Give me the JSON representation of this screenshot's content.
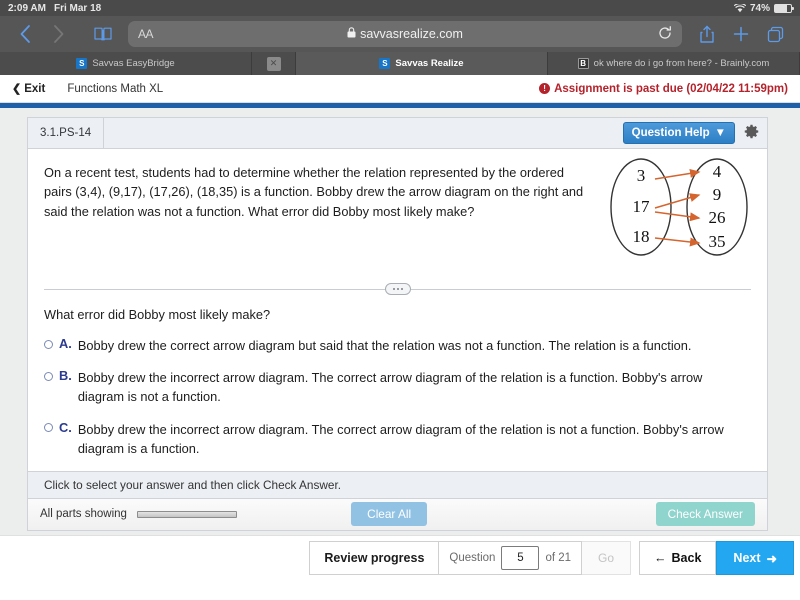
{
  "status_bar": {
    "time": "2:09 AM",
    "date": "Fri Mar 18",
    "battery_percent": "74%",
    "wifi_icon": "wifi-icon"
  },
  "browser": {
    "back_icon": "chevron-left-icon",
    "forward_icon": "chevron-right-icon",
    "bookmarks_icon": "book-icon",
    "text_size_label": "AA",
    "lock_icon": "lock-icon",
    "url": "savvasrealize.com",
    "reload_icon": "reload-icon",
    "share_icon": "share-icon",
    "new_tab_icon": "plus-icon",
    "tabs_icon": "tabs-icon",
    "tabs": [
      {
        "title": "Savvas EasyBridge",
        "favicon": "savvas-favicon",
        "active": false
      },
      {
        "title": "Savvas Realize",
        "favicon": "savvas-favicon",
        "active": true
      },
      {
        "title": "ok where do i go from here? - Brainly.com",
        "favicon": "brainly-favicon",
        "active": false
      }
    ],
    "close_tab_icon": "close-icon"
  },
  "app_bar": {
    "exit_label": "Exit",
    "exit_icon": "chevron-left-icon",
    "assignment_title": "Functions Math XL",
    "alert_icon": "exclamation-icon",
    "past_due_text": "Assignment is past due (02/04/22 11:59pm)"
  },
  "question_card": {
    "question_id": "3.1.PS-14",
    "question_help_label": "Question Help",
    "question_help_caret": "caret-down-icon",
    "settings_icon": "gear-icon",
    "question_text": "On a recent test, students had to determine whether the relation represented by the ordered pairs (3,4), (9,17), (17,26), (18,35) is a function. Bobby drew the arrow diagram on the right and said the relation was not a function. What error did Bobby most likely make?",
    "prompt": "What error did Bobby most likely make?",
    "splitter_icon": "drag-handle-icon",
    "diagram": {
      "left_set": [
        "3",
        "17",
        "18"
      ],
      "right_set": [
        "4",
        "9",
        "26",
        "35"
      ],
      "arrows": [
        {
          "from": "3",
          "to": "4"
        },
        {
          "from": "17",
          "to": "9"
        },
        {
          "from": "17",
          "to": "26"
        },
        {
          "from": "18",
          "to": "35"
        }
      ],
      "arrow_color": "#d4652f",
      "oval_color": "#333333"
    },
    "choices": [
      {
        "letter": "A.",
        "text": "Bobby drew the correct arrow diagram but said that the relation was not a function. The relation is a function.",
        "selected": false
      },
      {
        "letter": "B.",
        "text": "Bobby drew the incorrect arrow diagram. The correct arrow diagram of the relation is a function. Bobby's arrow diagram is not a function.",
        "selected": false
      },
      {
        "letter": "C.",
        "text": "Bobby drew the incorrect arrow diagram. The correct arrow diagram of the relation is not a function. Bobby's arrow diagram is a function.",
        "selected": false
      }
    ],
    "hint_text": "Click to select your answer and then click Check Answer.",
    "parts_label": "All parts showing",
    "clear_all_label": "Clear All",
    "check_answer_label": "Check Answer"
  },
  "bottom_nav": {
    "review_progress_label": "Review progress",
    "question_label": "Question",
    "question_number": "5",
    "of_label": "of 21",
    "go_label": "Go",
    "back_label": "Back",
    "back_icon": "arrow-left-icon",
    "next_label": "Next",
    "next_icon": "arrow-right-icon"
  },
  "colors": {
    "accent_blue": "#22a7f0",
    "help_blue": "#2c7fc6",
    "past_due_red": "#b4232c",
    "check_teal": "#8fd4cd",
    "clear_blue": "#91c2e4",
    "rule_blue": "#1f5fa9"
  }
}
